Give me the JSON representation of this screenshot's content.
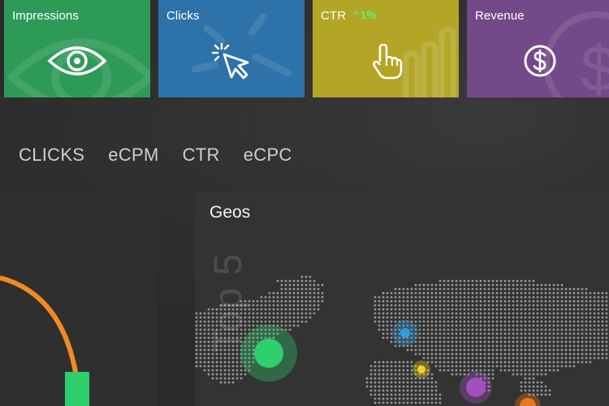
{
  "tiles": {
    "impressions": {
      "label": "Impressions",
      "icon": "eye-icon",
      "color": "#2e9a58"
    },
    "clicks": {
      "label": "Clicks",
      "icon": "cursor-click-icon",
      "color": "#2d72a8"
    },
    "ctr": {
      "label": "CTR",
      "delta": "1%",
      "icon": "pointing-hand-icon",
      "color": "#b3a526",
      "delta_color": "#5ff07a"
    },
    "revenue": {
      "label": "Revenue",
      "icon": "dollar-icon",
      "color": "#74498a"
    }
  },
  "metric_tabs": [
    "CLICKS",
    "eCPM",
    "CTR",
    "eCPC"
  ],
  "geos": {
    "title": "Geos",
    "subtitle": "Top 5",
    "markers": [
      {
        "name": "green",
        "color": "#2fcf6e"
      },
      {
        "name": "blue",
        "color": "#2f9be0"
      },
      {
        "name": "yellow",
        "color": "#f2d21a"
      },
      {
        "name": "purple",
        "color": "#a24fc4"
      },
      {
        "name": "orange",
        "color": "#e47a22"
      }
    ]
  },
  "accent": {
    "orange": "#f08a24",
    "green": "#2fcf6e"
  }
}
